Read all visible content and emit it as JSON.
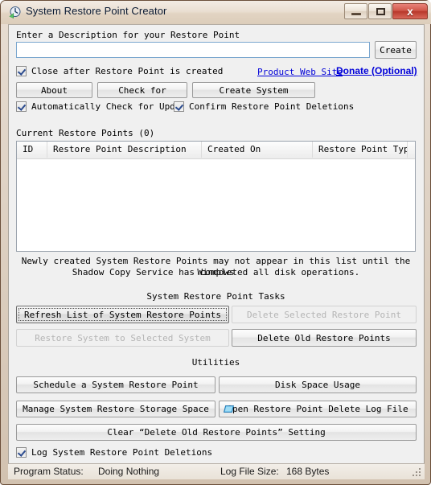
{
  "window": {
    "title": "System Restore Point Creator",
    "icon": "restore-clock-icon",
    "minimize_label": "",
    "maximize_label": "",
    "close_label": "x"
  },
  "description": {
    "label": "Enter a Description for your Restore Point",
    "input_value": "",
    "input_placeholder": "",
    "create_label": "Create"
  },
  "options": {
    "close_after_label": "Close after Restore Point is created",
    "close_after_checked": true,
    "auto_check_label": "Automatically Check for Updat",
    "auto_check_checked": true,
    "confirm_delete_label": "Confirm Restore Point Deletions",
    "confirm_delete_checked": true
  },
  "links": {
    "product_web_site": "Product Web Site",
    "donate": "Donate (Optional)",
    "link_color": "#0000d8"
  },
  "top_buttons": [
    {
      "label": "About",
      "name": "about-button",
      "disabled": false
    },
    {
      "label": "Check for",
      "name": "check-for-updates-button",
      "disabled": false
    },
    {
      "label": "Create System",
      "name": "create-system-button",
      "disabled": false
    }
  ],
  "restore_points": {
    "group_label": "Current Restore Points (0)",
    "count": 0,
    "columns": [
      "ID",
      "Restore Point Description",
      "Created On",
      "Restore Point Type"
    ],
    "rows": []
  },
  "note": {
    "line1": "Newly created System Restore Points may not appear in this list until the Windows",
    "line2": "Shadow Copy Service has completed all disk operations."
  },
  "tasks": {
    "title": "System Restore Point Tasks",
    "buttons": [
      {
        "label": "Refresh List of System Restore Points",
        "name": "refresh-list-button",
        "disabled": false,
        "focused": true
      },
      {
        "label": "Delete Selected Restore Point",
        "name": "delete-selected-restore-point-button",
        "disabled": true,
        "focused": false
      },
      {
        "label": "Restore System to Selected System",
        "name": "restore-system-button",
        "disabled": true,
        "focused": false
      },
      {
        "label": "Delete Old Restore Points",
        "name": "delete-old-restore-points-button",
        "disabled": false,
        "focused": false
      }
    ]
  },
  "utilities": {
    "title": "Utilities",
    "buttons": [
      {
        "label": "Schedule a System Restore Point",
        "name": "schedule-restore-point-button",
        "icon": ""
      },
      {
        "label": "Disk Space Usage",
        "name": "disk-space-usage-button",
        "icon": ""
      },
      {
        "label": "Manage System Restore Storage Space",
        "name": "manage-storage-space-button",
        "icon": ""
      },
      {
        "label": "Open Restore Point Delete Log File",
        "name": "open-delete-log-button",
        "icon": "file-icon"
      }
    ],
    "clear_setting_label": "Clear “Delete Old Restore Points” Setting",
    "log_deletions_label": "Log System Restore Point Deletions",
    "log_deletions_checked": true
  },
  "statusbar": {
    "program_status_label": "Program Status:",
    "program_status_value": "Doing Nothing",
    "log_file_label": "Log File Size:",
    "log_file_value": "168 Bytes"
  }
}
